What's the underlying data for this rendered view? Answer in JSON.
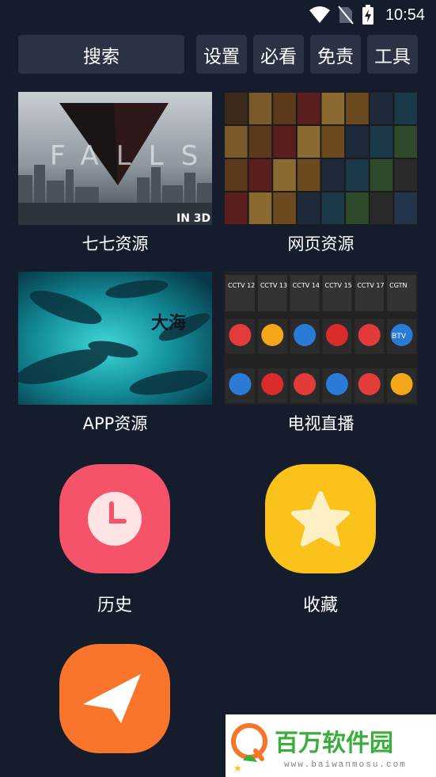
{
  "status": {
    "time": "10:54",
    "icons": [
      "wifi-icon",
      "no-sim-icon",
      "battery-charging-icon"
    ]
  },
  "toolbar": {
    "search_label": "搜索",
    "settings_label": "设置",
    "mustsee_label": "必看",
    "disclaimer_label": "免责",
    "tools_label": "工具"
  },
  "tiles": [
    {
      "label": "七七资源",
      "poster_text": "FALLS",
      "badge": "IN 3D"
    },
    {
      "label": "网页资源"
    },
    {
      "label": "APP资源",
      "poster_title": "大海"
    },
    {
      "label": "电视直播",
      "channels": [
        "CCTV 12",
        "CCTV 13",
        "CCTV 14",
        "CCTV 15",
        "CCTV 17",
        "CGTN",
        "BTV"
      ]
    }
  ],
  "shortcuts": {
    "history_label": "历史",
    "favorites_label": "收藏",
    "share_icon": "paper-plane-icon"
  },
  "watermark": {
    "title": "百万软件园",
    "url": "www.baiwanmosu.com"
  },
  "colors": {
    "background": "#151c2c",
    "button_bg": "#2a3243",
    "history": "#f4536a",
    "favorites": "#fcc21c",
    "share": "#f8752b",
    "watermark_green": "#3aae3c"
  }
}
